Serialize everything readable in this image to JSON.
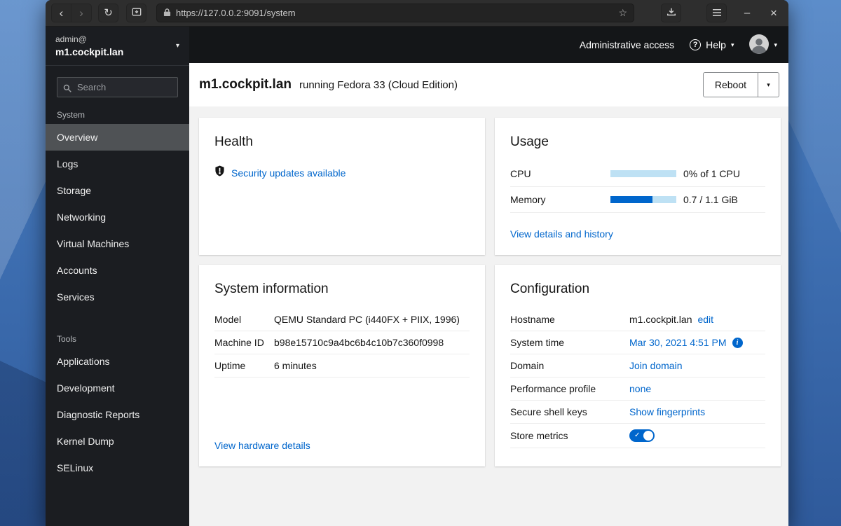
{
  "browser": {
    "url": "https://127.0.0.2:9091/system"
  },
  "icons": {
    "back": "‹",
    "forward": "›",
    "reload": "↻",
    "star": "☆",
    "minimize": "–",
    "close": "×",
    "caret": "▾",
    "check": "✓",
    "help": "?",
    "info": "i"
  },
  "sidebar": {
    "user": "admin@",
    "host": "m1.cockpit.lan",
    "search_placeholder": "Search",
    "selected_item": "Overview",
    "sections": [
      {
        "label": "System",
        "items": [
          "Overview",
          "Logs",
          "Storage",
          "Networking",
          "Virtual Machines",
          "Accounts",
          "Services"
        ]
      },
      {
        "label": "Tools",
        "items": [
          "Applications",
          "Development",
          "Diagnostic Reports",
          "Kernel Dump",
          "SELinux"
        ]
      }
    ]
  },
  "masthead": {
    "admin_access": "Administrative access",
    "help_label": "Help"
  },
  "page": {
    "hostname": "m1.cockpit.lan",
    "os": "running Fedora 33 (Cloud Edition)",
    "reboot_label": "Reboot"
  },
  "cards": {
    "health": {
      "title": "Health",
      "security_link": "Security updates available"
    },
    "usage": {
      "title": "Usage",
      "rows": [
        {
          "label": "CPU",
          "percent": 0,
          "value": "0% of 1 CPU"
        },
        {
          "label": "Memory",
          "percent": 64,
          "value": "0.7 / 1.1 GiB"
        }
      ],
      "link": "View details and history"
    },
    "system_info": {
      "title": "System information",
      "rows": [
        {
          "label": "Model",
          "value": "QEMU Standard PC (i440FX + PIIX, 1996)"
        },
        {
          "label": "Machine ID",
          "value": "b98e15710c9a4bc6b4c10b7c360f0998"
        },
        {
          "label": "Uptime",
          "value": "6 minutes"
        }
      ],
      "link": "View hardware details"
    },
    "configuration": {
      "title": "Configuration",
      "rows": [
        {
          "label": "Hostname",
          "value": "m1.cockpit.lan",
          "action": "edit"
        },
        {
          "label": "System time",
          "link": "Mar 30, 2021 4:51 PM"
        },
        {
          "label": "Domain",
          "link": "Join domain"
        },
        {
          "label": "Performance profile",
          "link": "none"
        },
        {
          "label": "Secure shell keys",
          "link": "Show fingerprints"
        },
        {
          "label": "Store metrics",
          "switch_on": true
        }
      ]
    }
  },
  "colors": {
    "accent_link": "#0066cc",
    "progress_track": "#bee1f4",
    "sidebar_bg": "#1b1d21",
    "masthead_bg": "#141618",
    "selected_item_bg": "#4f5255",
    "content_bg": "#f2f2f2"
  }
}
